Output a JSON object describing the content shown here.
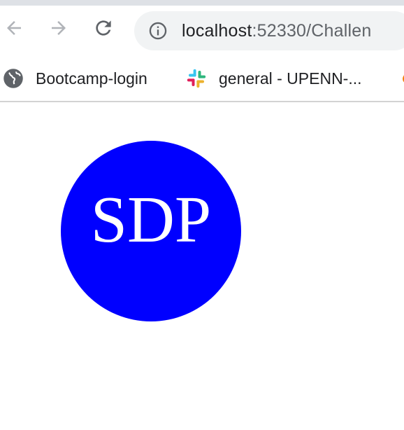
{
  "browser": {
    "nav": {
      "back_icon": "arrow-left-icon",
      "forward_icon": "arrow-right-icon",
      "reload_icon": "reload-icon"
    },
    "address_bar": {
      "info_icon": "info-circle-icon",
      "host": "localhost",
      "rest": ":52330/Challen"
    },
    "bookmarks": [
      {
        "icon": "globe-icon",
        "label": "Bootcamp-login"
      },
      {
        "icon": "slack-icon",
        "label": "general - UPENN-..."
      },
      {
        "icon": "fire-icon",
        "label": ""
      }
    ]
  },
  "page": {
    "logo": {
      "text": "SDP",
      "background_color": "#0000ff",
      "text_color": "#ffffff"
    }
  }
}
